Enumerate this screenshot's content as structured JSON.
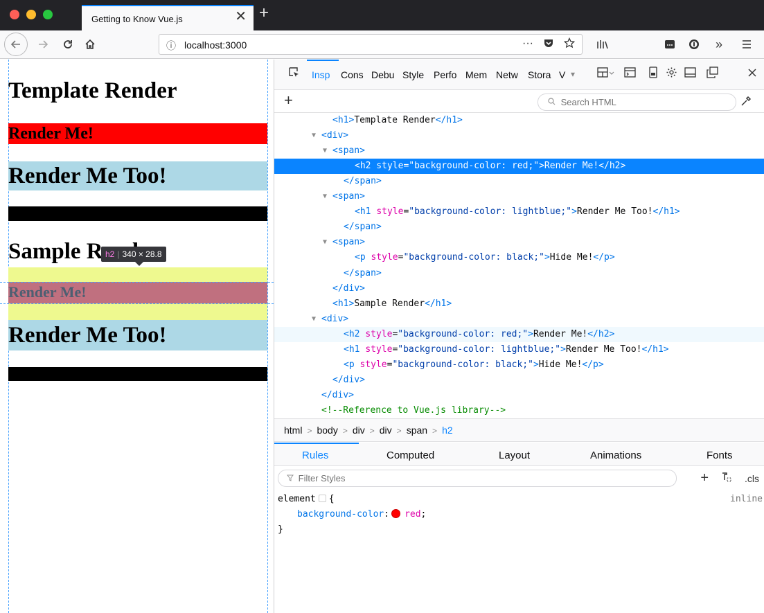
{
  "browser": {
    "tab_title": "Getting to Know Vue.js",
    "tab_close": "✕",
    "new_tab": "+",
    "url_info": "ⓘ",
    "url": "localhost:3000",
    "url_more": "···",
    "colors": {
      "close": "#ff5f57",
      "minimize": "#febc2e",
      "zoom": "#28c840",
      "accent": "#0a84ff"
    }
  },
  "page": {
    "template_title": "Template Render",
    "render_me": "Render Me!",
    "render_me_too": "Render Me Too!",
    "sample_title": "Sample Render",
    "sample_render_me": "Render Me!",
    "sample_render_me_too": "Render Me Too!",
    "infobar": {
      "tag": "h2",
      "size": "340 × 28.8"
    }
  },
  "devtools": {
    "tabs": [
      "Insp",
      "Cons",
      "Debu",
      "Style",
      "Perfo",
      "Mem",
      "Netw",
      "Stora",
      "V"
    ],
    "search_placeholder": "Search HTML",
    "add_button": "+",
    "markup": [
      {
        "indent": 4,
        "html": "<span class='t'>&lt;h1&gt;</span>Template Render<span class='t'>&lt;/h1&gt;</span>"
      },
      {
        "indent": 3,
        "twisty": true,
        "html": "<span class='t'>&lt;div&gt;</span>"
      },
      {
        "indent": 4,
        "twisty": true,
        "html": "<span class='t'>&lt;span&gt;</span>"
      },
      {
        "indent": 6,
        "selected": true,
        "html": "&lt;h2 style=\"background-color: red;\"&gt;Render Me!&lt;/h2&gt;"
      },
      {
        "indent": 5,
        "html": "<span class='t'>&lt;/span&gt;</span>"
      },
      {
        "indent": 4,
        "twisty": true,
        "html": "<span class='t'>&lt;span&gt;</span>"
      },
      {
        "indent": 6,
        "html": "<span class='t'>&lt;h1</span> <span class='a'>style</span>=<span class='v'>\"background-color: lightblue;\"</span><span class='t'>&gt;</span>Render Me Too!<span class='t'>&lt;/h1&gt;</span>"
      },
      {
        "indent": 5,
        "html": "<span class='t'>&lt;/span&gt;</span>"
      },
      {
        "indent": 4,
        "twisty": true,
        "html": "<span class='t'>&lt;span&gt;</span>"
      },
      {
        "indent": 6,
        "html": "<span class='t'>&lt;p</span> <span class='a'>style</span>=<span class='v'>\"background-color: black;\"</span><span class='t'>&gt;</span>Hide Me!<span class='t'>&lt;/p&gt;</span>"
      },
      {
        "indent": 5,
        "html": "<span class='t'>&lt;/span&gt;</span>"
      },
      {
        "indent": 4,
        "html": "<span class='t'>&lt;/div&gt;</span>"
      },
      {
        "indent": 4,
        "html": "<span class='t'>&lt;h1&gt;</span>Sample Render<span class='t'>&lt;/h1&gt;</span>"
      },
      {
        "indent": 3,
        "twisty": true,
        "html": "<span class='t'>&lt;div&gt;</span>"
      },
      {
        "indent": 5,
        "hover": true,
        "html": "<span class='t'>&lt;h2</span> <span class='a'>style</span>=<span class='v'>\"background-color: red;\"</span><span class='t'>&gt;</span>Render Me!<span class='t'>&lt;/h2&gt;</span>"
      },
      {
        "indent": 5,
        "html": "<span class='t'>&lt;h1</span> <span class='a'>style</span>=<span class='v'>\"background-color: lightblue;\"</span><span class='t'>&gt;</span>Render Me Too!<span class='t'>&lt;/h1&gt;</span>"
      },
      {
        "indent": 5,
        "html": "<span class='t'>&lt;p</span> <span class='a'>style</span>=<span class='v'>\"background-color: black;\"</span><span class='t'>&gt;</span>Hide Me!<span class='t'>&lt;/p&gt;</span>"
      },
      {
        "indent": 4,
        "html": "<span class='t'>&lt;/div&gt;</span>"
      },
      {
        "indent": 3,
        "html": "<span class='t'>&lt;/div&gt;</span>"
      },
      {
        "indent": 3,
        "html": "<span class='c'>&lt;!--Reference to Vue.js library--&gt;</span>"
      }
    ],
    "breadcrumbs": [
      "html",
      "body",
      "div",
      "div",
      "span",
      "h2"
    ],
    "side_tabs": [
      "Rules",
      "Computed",
      "Layout",
      "Animations",
      "Fonts"
    ],
    "filter_placeholder": "Filter Styles",
    "cls_label": ".cls",
    "rule": {
      "selector": "element",
      "open": "{",
      "source": "inline",
      "property": "background-color",
      "value": "red",
      "close": "}"
    }
  }
}
